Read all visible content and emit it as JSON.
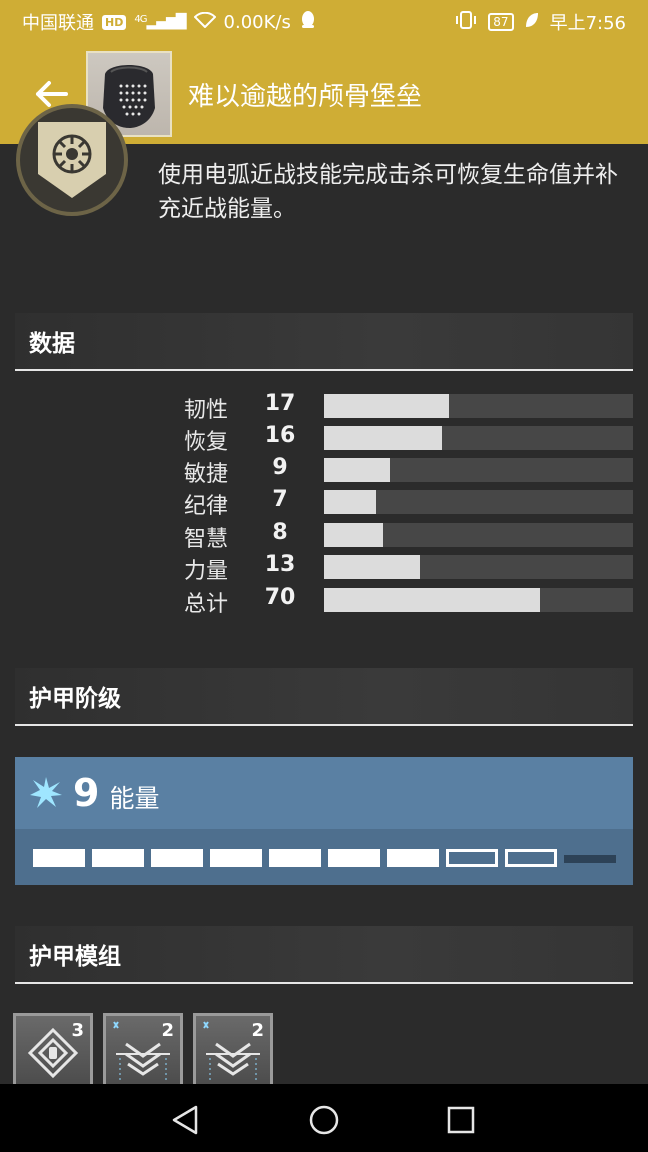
{
  "status": {
    "carrier": "中国联通",
    "hd": "HD",
    "network": "4G",
    "speed": "0.00K/s",
    "battery": "87",
    "time": "早上7:56"
  },
  "header": {
    "title": "难以逾越的颅骨堡垒"
  },
  "perk": {
    "description": "使用电弧近战技能完成击杀可恢复生命值并补充近战能量。"
  },
  "sections": {
    "stats_title": "数据",
    "tier_title": "护甲阶级",
    "mods_title": "护甲模组"
  },
  "stats": [
    {
      "label": "韧性",
      "value": "17",
      "fraction": 0.405
    },
    {
      "label": "恢复",
      "value": "16",
      "fraction": 0.381
    },
    {
      "label": "敏捷",
      "value": "9",
      "fraction": 0.214
    },
    {
      "label": "纪律",
      "value": "7",
      "fraction": 0.167
    },
    {
      "label": "智慧",
      "value": "8",
      "fraction": 0.19
    },
    {
      "label": "力量",
      "value": "13",
      "fraction": 0.31
    },
    {
      "label": "总计",
      "value": "70",
      "fraction": 0.7
    }
  ],
  "energy": {
    "value": "9",
    "label": "能量",
    "color": "#5a80a3",
    "segments": [
      "full",
      "full",
      "full",
      "full",
      "full",
      "full",
      "full",
      "empty",
      "empty",
      "dark"
    ]
  },
  "mods": [
    {
      "icon": "shield-mod-icon",
      "cost": "3"
    },
    {
      "icon": "arc-chevron-mod-icon",
      "cost": "2"
    },
    {
      "icon": "arc-chevron-mod-icon",
      "cost": "2"
    }
  ],
  "colors": {
    "accent": "#cfad35",
    "background": "#2b2b2b",
    "energy_arc": "#5a80a3"
  }
}
